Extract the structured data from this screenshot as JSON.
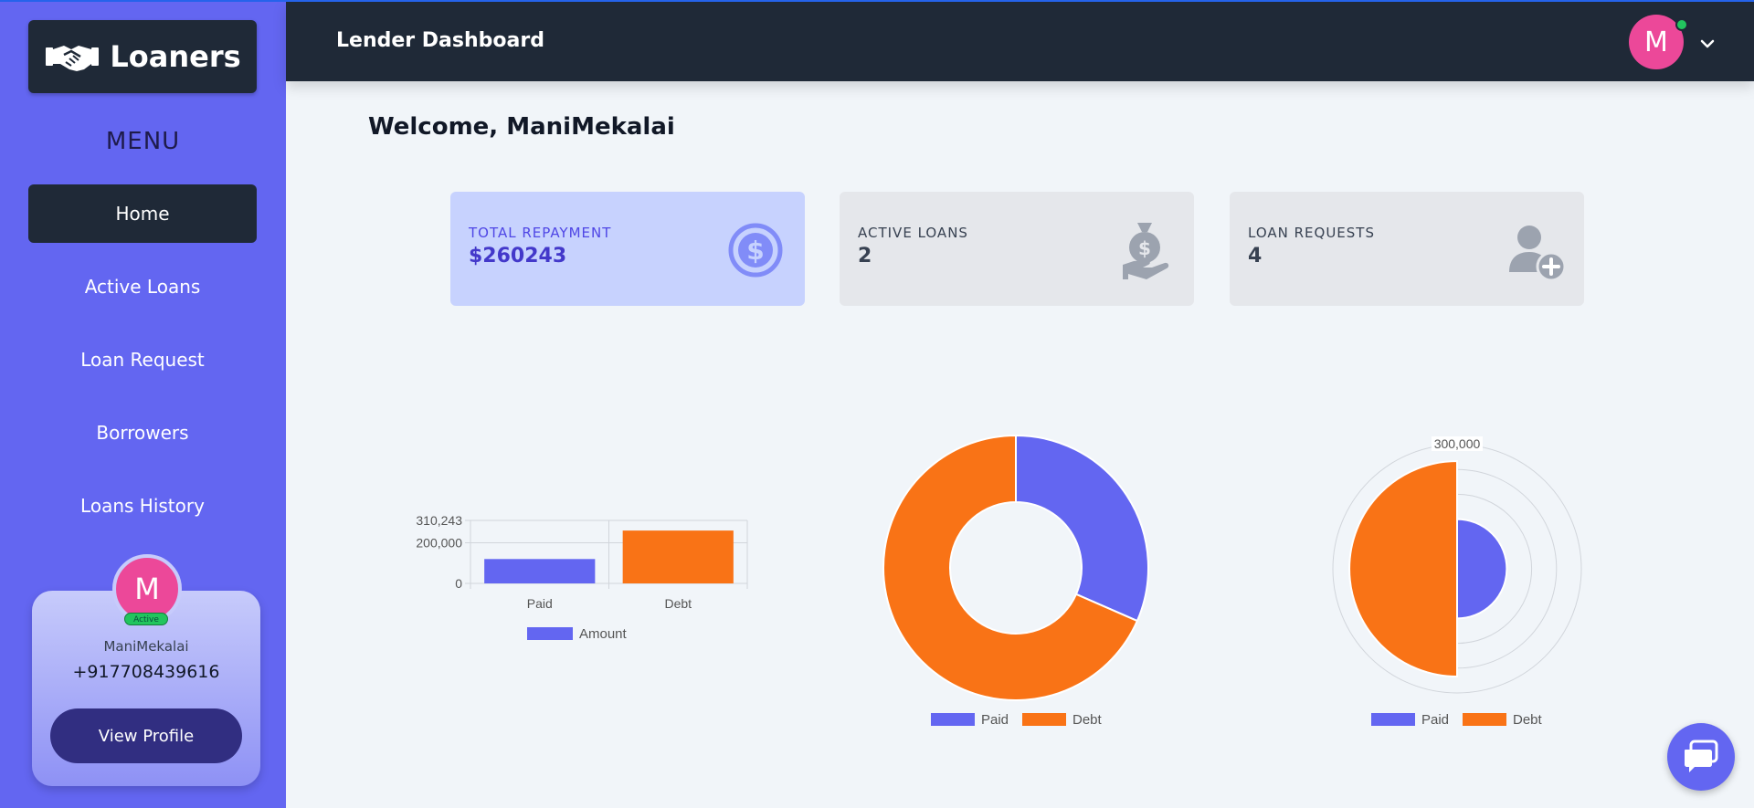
{
  "brand": {
    "name": "Loaners",
    "logo_icon": "handshake-icon"
  },
  "sidebar": {
    "menu_title": "MENU",
    "items": [
      {
        "label": "Home",
        "active": true
      },
      {
        "label": "Active Loans",
        "active": false
      },
      {
        "label": "Loan Request",
        "active": false
      },
      {
        "label": "Borrowers",
        "active": false
      },
      {
        "label": "Loans History",
        "active": false
      }
    ],
    "profile": {
      "initial": "M",
      "status": "Active",
      "name": "ManiMekalai",
      "phone": "+917708439616",
      "button_label": "View Profile"
    }
  },
  "header": {
    "title": "Lender Dashboard",
    "avatar_initial": "M"
  },
  "welcome": "Welcome, ManiMekalai",
  "cards": [
    {
      "label": "TOTAL REPAYMENT",
      "value": "$260243",
      "icon": "dollar-circle-icon"
    },
    {
      "label": "ACTIVE LOANS",
      "value": "2",
      "icon": "money-bag-hand-icon"
    },
    {
      "label": "LOAN REQUESTS",
      "value": "4",
      "icon": "user-add-icon"
    }
  ],
  "colors": {
    "paid": "#6366f1",
    "debt": "#f97316",
    "sidebar": "#6366f1",
    "header": "#1f2937"
  },
  "chart_data": [
    {
      "type": "bar",
      "categories": [
        "Paid",
        "Debt"
      ],
      "series": [
        {
          "name": "Amount",
          "values": [
            120000,
            260243
          ]
        }
      ],
      "y_ticks": [
        "0",
        "200,000",
        "310,243"
      ],
      "ylim": [
        0,
        310243
      ],
      "grid": true,
      "legend": "bottom"
    },
    {
      "type": "pie",
      "variant": "doughnut",
      "labels": [
        "Paid",
        "Debt"
      ],
      "values": [
        120000,
        260243
      ],
      "legend": "bottom"
    },
    {
      "type": "pie",
      "variant": "polar-area",
      "labels": [
        "Paid",
        "Debt"
      ],
      "values": [
        120000,
        260243
      ],
      "r_ticks": [
        "300,000"
      ],
      "rlim": [
        0,
        300000
      ],
      "legend": "bottom"
    }
  ]
}
